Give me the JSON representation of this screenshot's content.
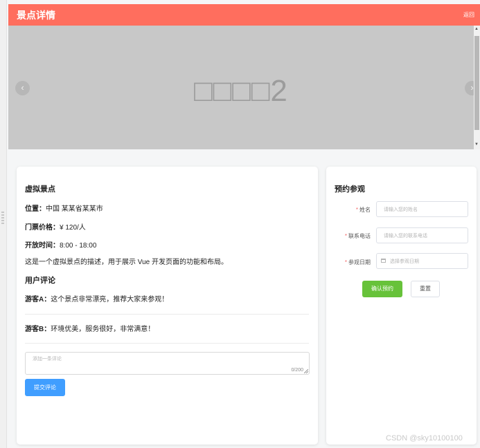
{
  "header": {
    "title": "景点详情",
    "back_label": "返回",
    "color": "#ff6e5e"
  },
  "carousel": {
    "slide_text": "□□□□2",
    "prev_icon": "chevron-left-icon",
    "next_icon": "chevron-right-icon"
  },
  "attraction": {
    "name": "虚拟景点",
    "location_label": "位置：",
    "location": "中国 某某省某某市",
    "price_label": "门票价格：",
    "price": "¥ 120/人",
    "hours_label": "开放时间：",
    "hours": "8:00 - 18:00",
    "description": "这是一个虚拟景点的描述，用于展示 Vue 开发页面的功能和布局。"
  },
  "reviews": {
    "heading": "用户评论",
    "items": [
      {
        "user": "游客A：",
        "text": "这个景点非常漂亮，推荐大家来参观！"
      },
      {
        "user": "游客B：",
        "text": "环境优美，服务很好，非常满意！"
      }
    ],
    "comment_placeholder": "添加一条评论",
    "comment_count": "0/200",
    "submit_label": "提交评论",
    "submit_color": "#409eff"
  },
  "booking": {
    "title": "预约参观",
    "fields": [
      {
        "label": "姓名",
        "placeholder": "请输入您的姓名"
      },
      {
        "label": "联系电话",
        "placeholder": "请输入您的联系电话"
      },
      {
        "label": "参观日期",
        "placeholder": "选择参观日期"
      }
    ],
    "confirm_label": "确认预约",
    "confirm_color": "#67c23a",
    "reset_label": "重置"
  },
  "watermark": "CSDN @sky10100100"
}
